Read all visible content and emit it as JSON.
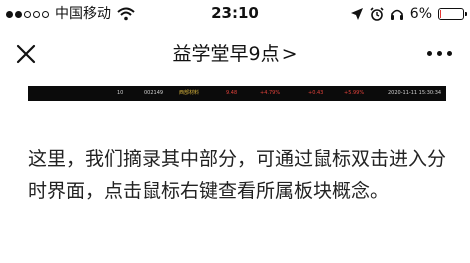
{
  "status_bar": {
    "carrier": "中国移动",
    "time": "23:10",
    "battery_text": "6%",
    "battery_level": 0.06,
    "icons": [
      "signal-dots",
      "wifi-icon",
      "location-icon",
      "alarm-icon",
      "headphones-icon",
      "battery-icon"
    ]
  },
  "nav": {
    "title": "益学堂早9点",
    "chevron": ">",
    "icons": [
      "close-icon",
      "more-icon"
    ]
  },
  "data_strip": {
    "cells": [
      "10",
      "002149",
      "西部材料",
      "9.48",
      "+4.79%",
      "+0.43",
      "+5.99%",
      "2020-11-11 15:30:34"
    ]
  },
  "article": {
    "text": "这里，我们摘录其中部分，可通过鼠标双击进入分时界面，点击鼠标右键查看所属板块概念。"
  },
  "colors": {
    "background": "#ffffff",
    "text": "#222222",
    "strip_bg": "#0b0b0b",
    "up_red": "#e0413a",
    "battery_low": "#e53935"
  }
}
